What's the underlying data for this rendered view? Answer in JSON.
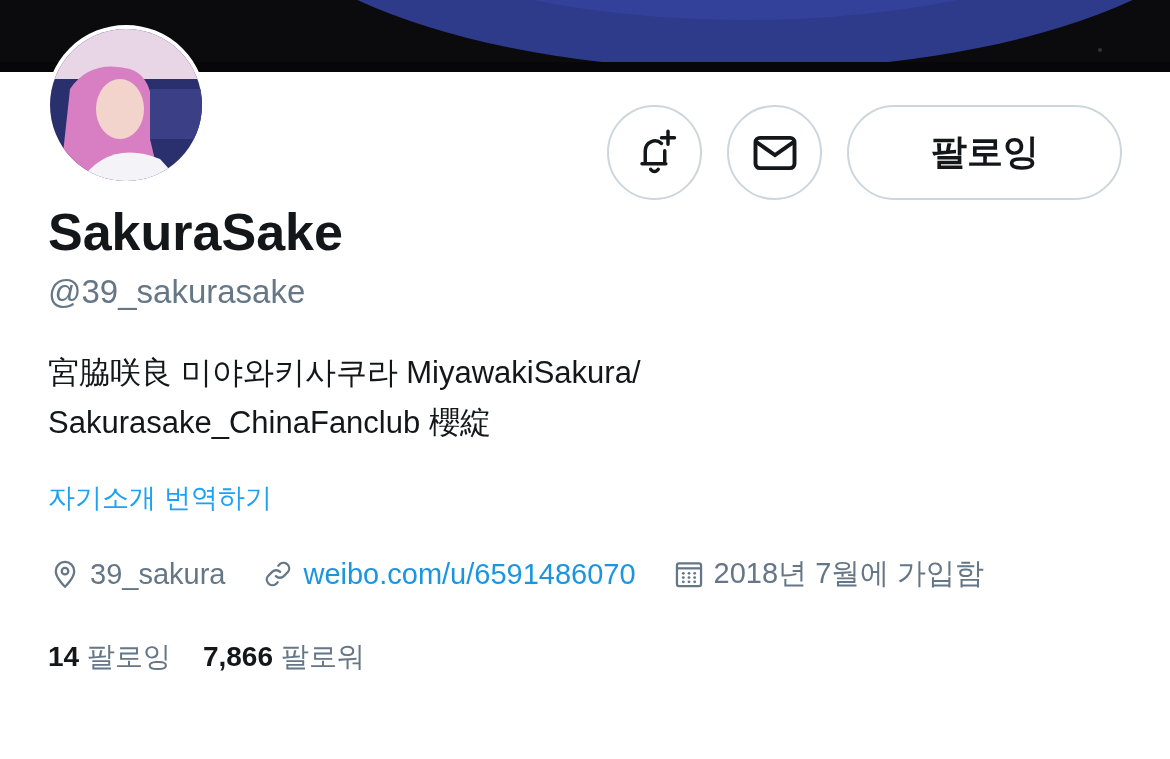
{
  "actions": [
    {
      "kind": "notify"
    },
    {
      "kind": "message"
    },
    {
      "kind": "follow",
      "label": "팔로잉"
    }
  ],
  "profile": {
    "name": "SakuraSake",
    "handle": "@39_sakurasake",
    "bio": "宮脇咲良 미야와키사쿠라 MiyawakiSakura/\nSakurasake_ChinaFanclub 櫻綻",
    "translate": "자기소개 번역하기"
  },
  "meta": [
    {
      "kind": "location",
      "text": "39_sakura"
    },
    {
      "kind": "link",
      "text": "weibo.com/u/6591486070"
    },
    {
      "kind": "joined",
      "text": "2018년 7월에 가입함"
    }
  ],
  "counts": [
    "**14** 팔로잉",
    "**7,866** 팔로워"
  ]
}
